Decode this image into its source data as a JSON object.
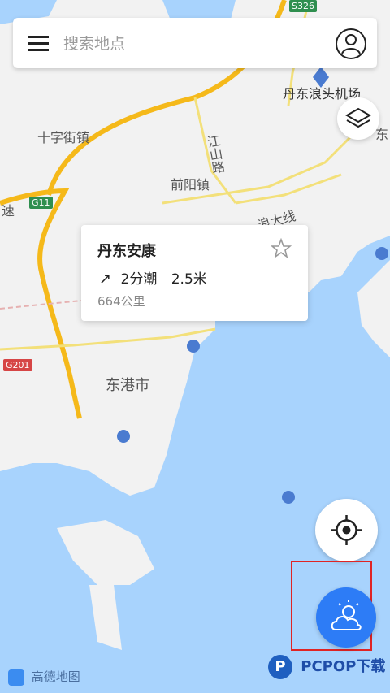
{
  "search": {
    "placeholder": "搜索地点"
  },
  "map_labels": {
    "airport": "丹东浪头机场",
    "east_edge": "东",
    "shizi": "十字街镇",
    "jiangshan": "江山路",
    "qianyang": "前阳镇",
    "highway_left": "速",
    "g11": "G11",
    "g201": "G201",
    "s326": "S326",
    "langda": "浪大线",
    "donggang": "东港市"
  },
  "tide_card": {
    "title": "丹东安康",
    "tide": "2分潮",
    "height": "2.5米",
    "distance": "664公里"
  },
  "footer": {
    "map_logo": "高德地图",
    "watermark": "PCPOP下载"
  },
  "colors": {
    "water": "#a8d3fd",
    "land": "#f2f2f2",
    "accent": "#2d7cf6",
    "highlight": "#e02424"
  }
}
